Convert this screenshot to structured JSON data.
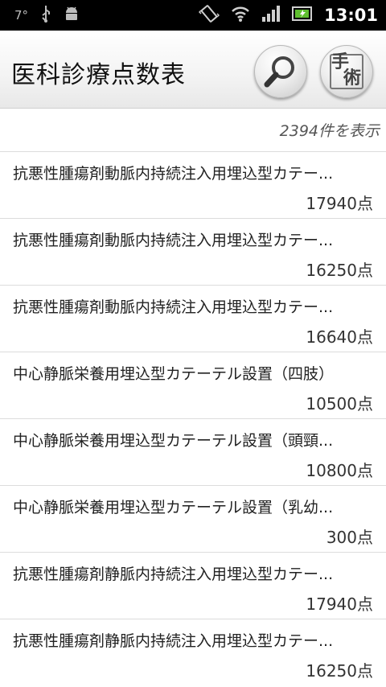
{
  "status_bar": {
    "temperature": "7°",
    "time": "13:01",
    "icons": [
      "usb-icon",
      "android-debug-icon",
      "vibrate-icon",
      "wifi-icon",
      "signal-icon",
      "battery-icon"
    ]
  },
  "header": {
    "title": "医科診療点数表",
    "surgery_label_1": "手",
    "surgery_label_2": "術"
  },
  "result_count": "2394件を表示",
  "items": [
    {
      "name": "抗悪性腫瘍剤動脈内持続注入用埋込型カテー...",
      "points": "17940点"
    },
    {
      "name": "抗悪性腫瘍剤動脈内持続注入用埋込型カテー...",
      "points": "16250点"
    },
    {
      "name": "抗悪性腫瘍剤動脈内持続注入用埋込型カテー...",
      "points": "16640点"
    },
    {
      "name": "中心静脈栄養用埋込型カテーテル設置（四肢）",
      "points": "10500点"
    },
    {
      "name": "中心静脈栄養用埋込型カテーテル設置（頭頸...",
      "points": "10800点"
    },
    {
      "name": "中心静脈栄養用埋込型カテーテル設置（乳幼...",
      "points": "300点"
    },
    {
      "name": "抗悪性腫瘍剤静脈内持続注入用埋込型カテー...",
      "points": "17940点"
    },
    {
      "name": "抗悪性腫瘍剤静脈内持続注入用埋込型カテー...",
      "points": "16250点"
    }
  ]
}
